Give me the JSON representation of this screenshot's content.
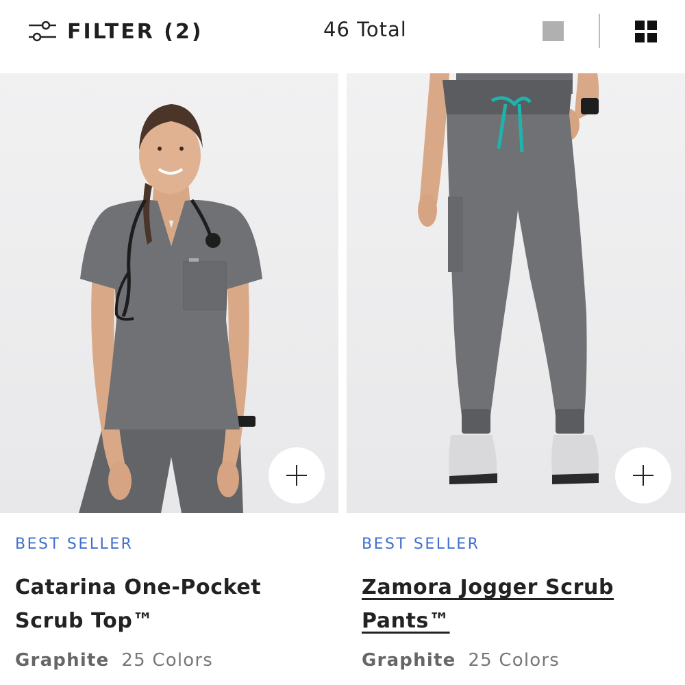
{
  "toolbar": {
    "filter_label": "FILTER (2)",
    "total_label": "46 Total",
    "icons": [
      "sliders-icon",
      "single-view-icon",
      "grid-view-icon"
    ],
    "single_view_color": "#b0b0b0",
    "grid_view_color": "#111111"
  },
  "products": [
    {
      "badge": "BEST SELLER",
      "title": "Catarina One-Pocket Scrub Top™",
      "color_name": "Graphite",
      "colors_count": "25 Colors",
      "add_icon": "plus-icon"
    },
    {
      "badge": "BEST SELLER",
      "title": "Zamora Jogger Scrub Pants™",
      "color_name": "Graphite",
      "colors_count": "25 Colors",
      "add_icon": "plus-icon"
    }
  ],
  "colors": {
    "badge": "#3f6fcf",
    "scrub": "#6e6f73",
    "drawstring": "#1fb3ad",
    "photo_background": "#eeeeef"
  }
}
